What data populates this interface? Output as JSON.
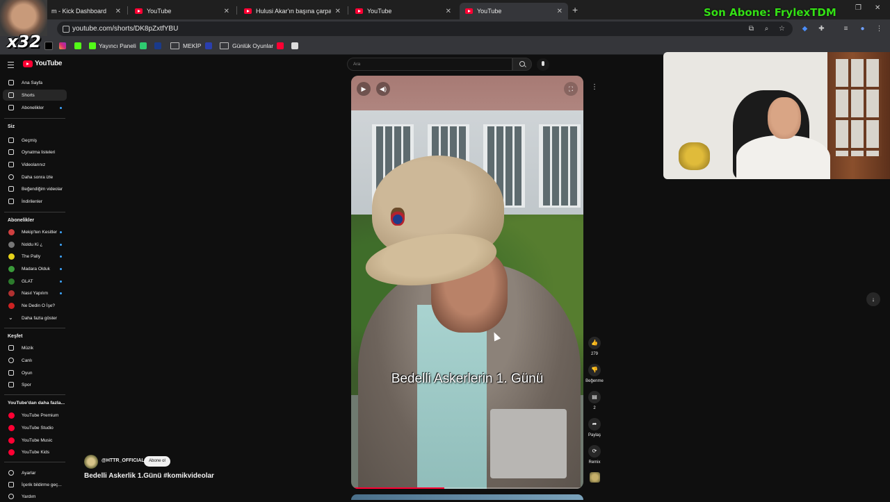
{
  "browser": {
    "tabs": [
      {
        "title": "m - Kick Dashboard",
        "favicon": "kick-icon"
      },
      {
        "title": "YouTube",
        "favicon": "youtube-icon"
      },
      {
        "title": "Hulusi Akar'ın başına çarpan as",
        "favicon": "youtube-icon"
      },
      {
        "title": "YouTube",
        "favicon": "youtube-icon"
      },
      {
        "title": "YouTube",
        "favicon": "youtube-icon",
        "active": true
      }
    ],
    "url": "youtube.com/shorts/DK8pZxtfYBU",
    "bookmarks": {
      "yayinci_paneli": "Yayıncı Paneli",
      "mekip": "MEKİP",
      "gunluk_oyunlar": "Günlük Oyunlar"
    }
  },
  "stream_overlay": {
    "last_sub": "Son Abone: FrylexTDM",
    "multiplier": "x32"
  },
  "sidebar": {
    "logo": "YouTube",
    "main": [
      {
        "label": "Ana Sayfa",
        "icon": "home-icon"
      },
      {
        "label": "Shorts",
        "icon": "shorts-icon",
        "active": true
      },
      {
        "label": "Abonelikler",
        "icon": "subscriptions-icon"
      }
    ],
    "you_header": "Siz",
    "you": [
      {
        "label": "Geçmiş",
        "icon": "history-icon"
      },
      {
        "label": "Oynatma listeleri",
        "icon": "playlist-icon"
      },
      {
        "label": "Videolarınız",
        "icon": "video-icon"
      },
      {
        "label": "Daha sonra izle",
        "icon": "clock-icon"
      },
      {
        "label": "Beğendiğim videolar",
        "icon": "like-icon"
      },
      {
        "label": "İndirilenler",
        "icon": "download-icon"
      }
    ],
    "subs_header": "Abonelikler",
    "subs": [
      {
        "label": "Mekip'ten Kesitler",
        "color": "#d04040"
      },
      {
        "label": "Noldu Ki ¿",
        "color": "#777777"
      },
      {
        "label": "The Pally",
        "color": "#e6d21a"
      },
      {
        "label": "Madara Olduk",
        "color": "#3a9a3a"
      },
      {
        "label": "GLAT",
        "color": "#2c7a2c"
      },
      {
        "label": "Nasıl Yapılım",
        "color": "#b03030"
      },
      {
        "label": "Ne Dedin O İşe?",
        "color": "#cc2222"
      },
      {
        "label": "Daha fazla göster",
        "icon": "chevron-down-icon"
      }
    ],
    "explore_header": "Keşfet",
    "explore": [
      {
        "label": "Müzik",
        "icon": "music-icon"
      },
      {
        "label": "Canlı",
        "icon": "live-icon"
      },
      {
        "label": "Oyun",
        "icon": "gaming-icon"
      },
      {
        "label": "Spor",
        "icon": "trophy-icon"
      }
    ],
    "more_header": "YouTube'dan daha fazla...",
    "more": [
      {
        "label": "YouTube Premium"
      },
      {
        "label": "YouTube Studio"
      },
      {
        "label": "YouTube Music"
      },
      {
        "label": "YouTube Kids"
      }
    ],
    "settings": [
      {
        "label": "Ayarlar",
        "icon": "gear-icon"
      },
      {
        "label": "İçerik bildirme geç...",
        "icon": "flag-icon"
      },
      {
        "label": "Yardım",
        "icon": "help-icon"
      }
    ]
  },
  "search": {
    "placeholder": "Ara"
  },
  "short": {
    "caption": "Bedelli Askerlerin 1. Günü",
    "progress": 0.4,
    "channel": "@HTTR_OFFICIAL",
    "subscribe": "Abone ol",
    "title": "Bedelli Askerlik 1.Günü #komikvideolar"
  },
  "actions": {
    "likes": "279",
    "dislike": "Beğenme",
    "comments": "2",
    "share": "Paylaş",
    "remix": "Remix"
  }
}
